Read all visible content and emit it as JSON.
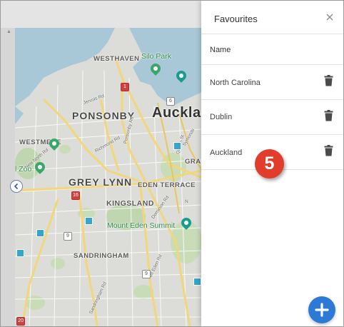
{
  "panel": {
    "title": "Favourites",
    "column_header": "Name",
    "items": [
      {
        "name": "North Carolina"
      },
      {
        "name": "Dublin"
      },
      {
        "name": "Auckland"
      }
    ]
  },
  "annotation": {
    "step": "5"
  },
  "map": {
    "labels": {
      "westhaven": "WESTHAVEN",
      "silo_park": "Silo Park",
      "ponsonby": "PONSONBY",
      "auckland": "Auckla",
      "westmere": "WESTMERE",
      "zoo": "l Zoo",
      "grey_lynn": "GREY LYNN",
      "eden_terrace": "EDEN TERRACE",
      "kingsland": "KINGSLAND",
      "graft": "GRAFT",
      "mount_eden": "Mount Eden Summit",
      "sandringham": "SANDRINGHAM",
      "symonds": "Symonds",
      "queen": "Queen St",
      "jervois": "Jervois Rd",
      "richmond": "Richmond Rd",
      "ponsonby_rd": "Ponsonby Rd",
      "new_north": "New North Rd",
      "dominion": "Dominion Rd",
      "sandringham_rd": "Sandringham Rd",
      "mt_eden_rd": "Mt Eden Rd",
      "n_label": "N"
    },
    "shields": {
      "s1": "1",
      "s6": "6",
      "s16": "16",
      "s9": "9",
      "s9b": "9",
      "s20": "20"
    }
  },
  "colors": {
    "accent": "#2d7ad6",
    "badge": "#e23c2c"
  }
}
